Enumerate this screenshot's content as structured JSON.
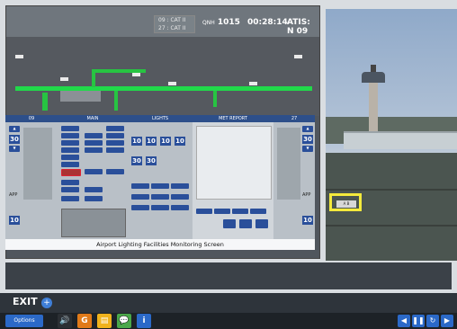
{
  "monitor": {
    "cat_lines": [
      "09 : CAT II",
      "27 : CAT II"
    ],
    "qnh_label": "QNH",
    "qnh_value": "1015",
    "time": "00:28:14",
    "atis": "ATIS: N 09"
  },
  "panels": {
    "left_runway": "09",
    "main": "MAIN",
    "lights": "LIGHTS",
    "met_report": "MET REPORT",
    "right_runway": "27",
    "left_app_label": "APP",
    "right_app_label": "APP",
    "left_value_top": "30",
    "left_value_mid": "10",
    "right_value_top": "30",
    "right_value_mid": "10",
    "light_values_row1": [
      "10",
      "10",
      "10",
      "10"
    ],
    "light_values_row2": [
      "30",
      "30"
    ]
  },
  "screen_title": "Airport Lighting Facilities Monitoring Screen",
  "photo": {
    "highlight_label": "A B"
  },
  "exit": {
    "label": "EXIT"
  },
  "toolbar": {
    "options_label": "Options"
  },
  "colors": {
    "runway_green": "#21d94a",
    "panel_blue": "#2a4f9a",
    "highlight_yellow": "#f4ea3c",
    "options_blue": "#2b69c8"
  },
  "icons": {
    "exit_icon": "plus-circle-icon",
    "speaker_icon": "speaker-icon",
    "g_icon": "g-icon",
    "notes_icon": "notes-icon",
    "chat_icon": "chat-icon",
    "info_icon": "info-icon",
    "prev_icon": "prev-icon",
    "pause_icon": "pause-icon",
    "replay_icon": "replay-icon",
    "next_icon": "next-icon"
  }
}
